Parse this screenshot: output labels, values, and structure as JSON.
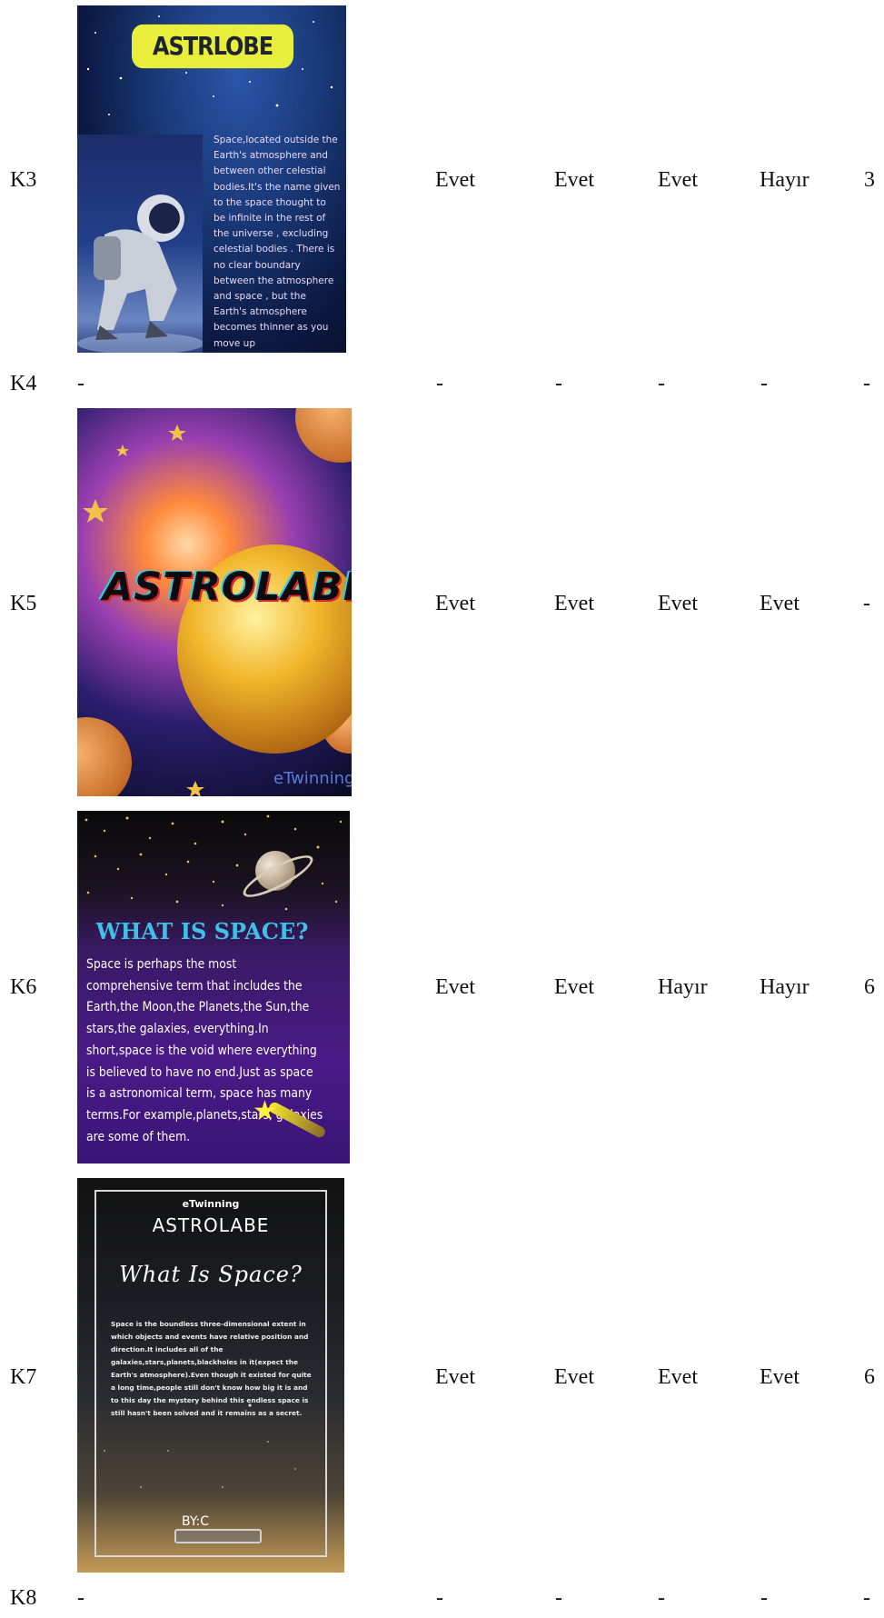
{
  "rows": [
    {
      "id": "K3",
      "cols": [
        "Evet",
        "Evet",
        "Evet",
        "Hayır",
        "3"
      ],
      "poster": {
        "title": "ASTRLOBE",
        "text": "Space,located outside the Earth's atmosphere and between other celestial bodies.It's the name given to the space thought to be infinite in the rest of the universe , excluding celestial bodies . There is no clear boundary between the atmosphere and space , but the Earth's atmosphere becomes thinner as you move up"
      }
    },
    {
      "id": "K4",
      "image": "-",
      "cols": [
        "-",
        "-",
        "-",
        "-",
        "-"
      ]
    },
    {
      "id": "K5",
      "cols": [
        "Evet",
        "Evet",
        "Evet",
        "Evet",
        "-"
      ],
      "poster": {
        "title": "ASTROLABE",
        "logo": "eTwinning"
      }
    },
    {
      "id": "K6",
      "cols": [
        "Evet",
        "Evet",
        "Hayır",
        "Hayır",
        "6"
      ],
      "poster": {
        "title": "WHAT IS SPACE?",
        "text": "Space is perhaps the most comprehensive term that includes the Earth,the Moon,the Planets,the Sun,the stars,the galaxies, everything.In short,space is the void where everything is believed to have no end.Just as space is a astronomical term, space has many terms.For example,planets,stars, galaxies are some of them."
      }
    },
    {
      "id": "K7",
      "cols": [
        "Evet",
        "Evet",
        "Evet",
        "Evet",
        "6"
      ],
      "poster": {
        "logo": "eTwinning",
        "brand": "ASTROLABE",
        "title": "What Is Space?",
        "text": "Space is the boundless three-dimensional extent in which objects and events have relative position and direction.It includes all of the galaxies,stars,planets,blackholes in it(expect the Earth's atmosphere).Even though it existed for quite a long time,people still don't know how big it is and to this day the mystery behind this endless space is still hasn't been solved and it remains as a secret.",
        "byline": "BY:C"
      }
    },
    {
      "id": "K8",
      "image": "-",
      "cols": [
        "-",
        "-",
        "-",
        "-",
        "-"
      ]
    }
  ]
}
